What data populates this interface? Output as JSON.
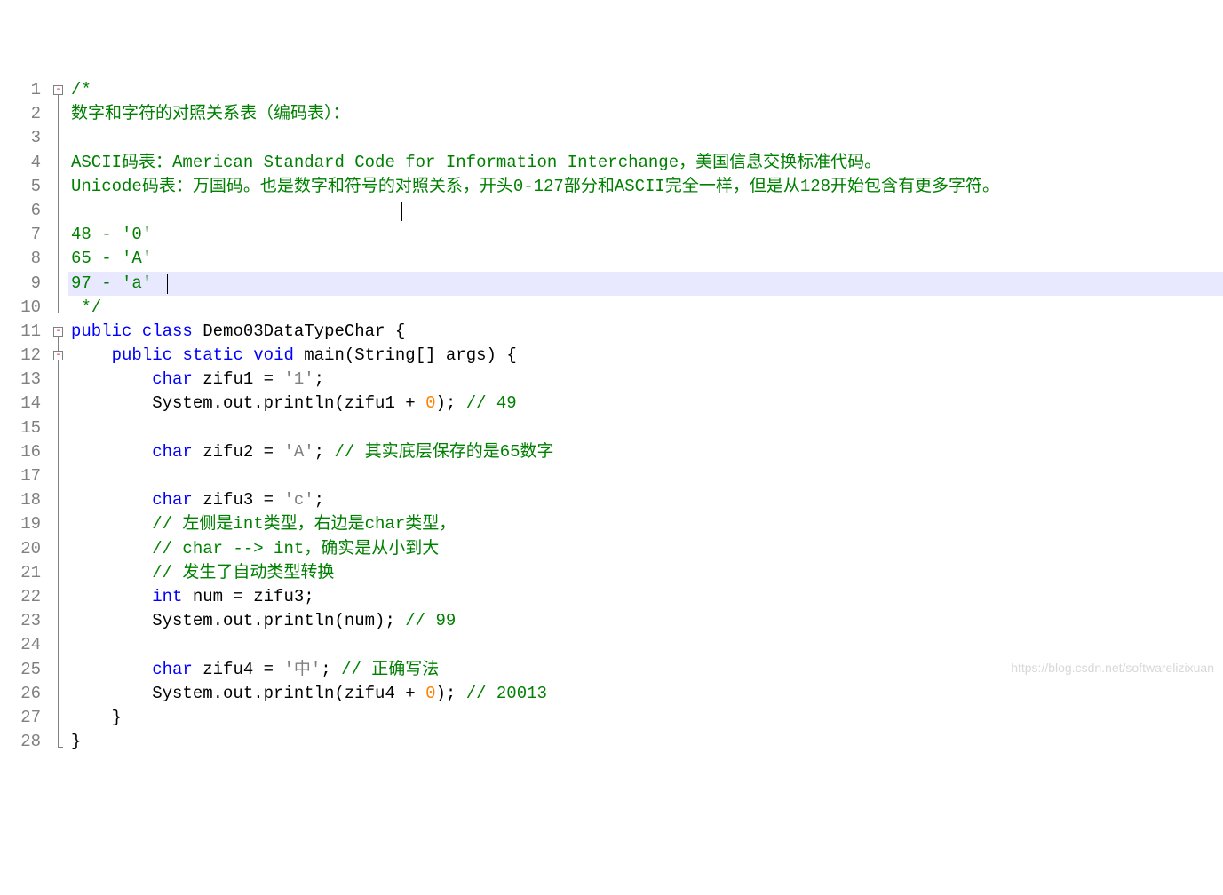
{
  "lineCount": 28,
  "highlightLine": 9,
  "foldMarkers": [
    {
      "line": 1,
      "symbol": "-"
    },
    {
      "line": 11,
      "symbol": "-"
    },
    {
      "line": 12,
      "symbol": "-"
    }
  ],
  "foldLines": [
    {
      "from": 1,
      "to": 10
    },
    {
      "from": 11,
      "to": 28
    }
  ],
  "cursors": [
    {
      "line": 6,
      "colPx": 452
    },
    {
      "line": 9,
      "colPx": 188
    }
  ],
  "lines": [
    {
      "tokens": [
        {
          "cls": "c-comment",
          "text": "/*"
        }
      ]
    },
    {
      "tokens": [
        {
          "cls": "c-comment",
          "text": "数字和字符的对照关系表（编码表）："
        }
      ]
    },
    {
      "tokens": [
        {
          "cls": "c-comment",
          "text": ""
        }
      ]
    },
    {
      "tokens": [
        {
          "cls": "c-comment",
          "text": "ASCII码表：American Standard Code for Information Interchange，美国信息交换标准代码。"
        }
      ]
    },
    {
      "tokens": [
        {
          "cls": "c-comment",
          "text": "Unicode码表：万国码。也是数字和符号的对照关系，开头0-127部分和ASCII完全一样，但是从128开始包含有更多字符。"
        }
      ]
    },
    {
      "tokens": [
        {
          "cls": "c-comment",
          "text": ""
        }
      ]
    },
    {
      "tokens": [
        {
          "cls": "c-comment",
          "text": "48 - '0'"
        }
      ]
    },
    {
      "tokens": [
        {
          "cls": "c-comment",
          "text": "65 - 'A'"
        }
      ]
    },
    {
      "tokens": [
        {
          "cls": "c-comment",
          "text": "97 - 'a'"
        }
      ]
    },
    {
      "tokens": [
        {
          "cls": "c-comment",
          "text": " */"
        }
      ]
    },
    {
      "tokens": [
        {
          "cls": "c-keyword",
          "text": "public "
        },
        {
          "cls": "c-keyword",
          "text": "class "
        },
        {
          "cls": "c-default",
          "text": "Demo03DataTypeChar {"
        }
      ]
    },
    {
      "tokens": [
        {
          "cls": "c-default",
          "text": "    "
        },
        {
          "cls": "c-keyword",
          "text": "public "
        },
        {
          "cls": "c-keyword",
          "text": "static "
        },
        {
          "cls": "c-keyword",
          "text": "void "
        },
        {
          "cls": "c-default",
          "text": "main(String[] args) {"
        }
      ]
    },
    {
      "tokens": [
        {
          "cls": "c-default",
          "text": "        "
        },
        {
          "cls": "c-keyword",
          "text": "char "
        },
        {
          "cls": "c-default",
          "text": "zifu1 = "
        },
        {
          "cls": "c-string",
          "text": "'1'"
        },
        {
          "cls": "c-default",
          "text": ";"
        }
      ]
    },
    {
      "tokens": [
        {
          "cls": "c-default",
          "text": "        System.out.println(zifu1 + "
        },
        {
          "cls": "c-number",
          "text": "0"
        },
        {
          "cls": "c-default",
          "text": "); "
        },
        {
          "cls": "c-comment",
          "text": "// 49"
        }
      ]
    },
    {
      "tokens": [
        {
          "cls": "c-default",
          "text": ""
        }
      ]
    },
    {
      "tokens": [
        {
          "cls": "c-default",
          "text": "        "
        },
        {
          "cls": "c-keyword",
          "text": "char "
        },
        {
          "cls": "c-default",
          "text": "zifu2 = "
        },
        {
          "cls": "c-string",
          "text": "'A'"
        },
        {
          "cls": "c-default",
          "text": "; "
        },
        {
          "cls": "c-comment",
          "text": "// 其实底层保存的是65数字"
        }
      ]
    },
    {
      "tokens": [
        {
          "cls": "c-default",
          "text": ""
        }
      ]
    },
    {
      "tokens": [
        {
          "cls": "c-default",
          "text": "        "
        },
        {
          "cls": "c-keyword",
          "text": "char "
        },
        {
          "cls": "c-default",
          "text": "zifu3 = "
        },
        {
          "cls": "c-string",
          "text": "'c'"
        },
        {
          "cls": "c-default",
          "text": ";"
        }
      ]
    },
    {
      "tokens": [
        {
          "cls": "c-default",
          "text": "        "
        },
        {
          "cls": "c-comment",
          "text": "// 左侧是int类型，右边是char类型，"
        }
      ]
    },
    {
      "tokens": [
        {
          "cls": "c-default",
          "text": "        "
        },
        {
          "cls": "c-comment",
          "text": "// char --> int，确实是从小到大"
        }
      ]
    },
    {
      "tokens": [
        {
          "cls": "c-default",
          "text": "        "
        },
        {
          "cls": "c-comment",
          "text": "// 发生了自动类型转换"
        }
      ]
    },
    {
      "tokens": [
        {
          "cls": "c-default",
          "text": "        "
        },
        {
          "cls": "c-keyword",
          "text": "int "
        },
        {
          "cls": "c-default",
          "text": "num = zifu3;"
        }
      ]
    },
    {
      "tokens": [
        {
          "cls": "c-default",
          "text": "        System.out.println(num); "
        },
        {
          "cls": "c-comment",
          "text": "// 99"
        }
      ]
    },
    {
      "tokens": [
        {
          "cls": "c-default",
          "text": ""
        }
      ]
    },
    {
      "tokens": [
        {
          "cls": "c-default",
          "text": "        "
        },
        {
          "cls": "c-keyword",
          "text": "char "
        },
        {
          "cls": "c-default",
          "text": "zifu4 = "
        },
        {
          "cls": "c-string",
          "text": "'中'"
        },
        {
          "cls": "c-default",
          "text": "; "
        },
        {
          "cls": "c-comment",
          "text": "// 正确写法"
        }
      ]
    },
    {
      "tokens": [
        {
          "cls": "c-default",
          "text": "        System.out.println(zifu4 + "
        },
        {
          "cls": "c-number",
          "text": "0"
        },
        {
          "cls": "c-default",
          "text": "); "
        },
        {
          "cls": "c-comment",
          "text": "// 20013"
        }
      ]
    },
    {
      "tokens": [
        {
          "cls": "c-default",
          "text": "    }"
        }
      ]
    },
    {
      "tokens": [
        {
          "cls": "c-default",
          "text": "}"
        }
      ]
    }
  ],
  "watermark": "https://blog.csdn.net/softwarelizixuan"
}
